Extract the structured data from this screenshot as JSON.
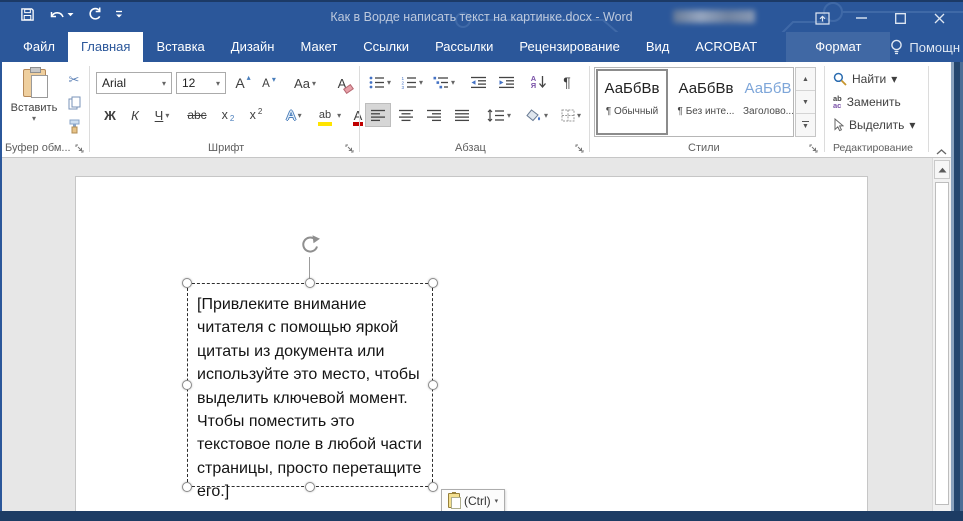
{
  "colors": {
    "accent": "#2b579a",
    "title_edge": "#1c3a66",
    "heading_style_blue": "#7ea6d9",
    "font_color_red": "#c00000",
    "highlight_yellow": "#ffe400"
  },
  "titlebar": {
    "title": "Как в Ворде написать текст на картинке.docx - Word"
  },
  "tabs": [
    {
      "label": "Файл",
      "active": false
    },
    {
      "label": "Главная",
      "active": true
    },
    {
      "label": "Вставка",
      "active": false
    },
    {
      "label": "Дизайн",
      "active": false
    },
    {
      "label": "Макет",
      "active": false
    },
    {
      "label": "Ссылки",
      "active": false
    },
    {
      "label": "Рассылки",
      "active": false
    },
    {
      "label": "Рецензирование",
      "active": false
    },
    {
      "label": "Вид",
      "active": false
    },
    {
      "label": "ACROBAT",
      "active": false
    },
    {
      "label": "Формат",
      "active": false,
      "contextual": true
    }
  ],
  "help_label": "Помощн",
  "icons": {
    "qat": [
      "floppy-save",
      "undo-arrow",
      "redo-arrow",
      "customize-qat-chevron"
    ],
    "window": [
      "ribbon-display-options",
      "minimize",
      "maximize",
      "close"
    ],
    "tab_extras": [
      "lightbulb",
      "person-plus-share",
      "comment-bubble"
    ]
  },
  "ribbon": {
    "clipboard": {
      "paste_label": "Вставить",
      "group_label": "Буфер обм..."
    },
    "font": {
      "family_value": "Arial",
      "size_value": "12",
      "grow_font": "А",
      "shrink_font": "А",
      "change_case": "Aa",
      "clear_format": "А",
      "bold": "Ж",
      "italic": "К",
      "underline": "Ч",
      "strikethrough": "abc",
      "subscript_base": "x",
      "subscript_small": "2",
      "superscript_base": "x",
      "superscript_small": "2",
      "text_effects": "А",
      "highlight": "ab",
      "font_color": "А",
      "group_label": "Шрифт"
    },
    "paragraph": {
      "sort_top": "А",
      "sort_bottom": "Я",
      "pilcrow": "¶",
      "group_label": "Абзац"
    },
    "styles": {
      "items": [
        {
          "preview": "АаБбВв",
          "label": "¶ Обычный"
        },
        {
          "preview": "АаБбВв",
          "label": "¶ Без инте..."
        },
        {
          "preview": "АаБбВ",
          "label": "Заголово..."
        }
      ],
      "group_label": "Стили"
    },
    "editing": {
      "find_label": "Найти",
      "replace_label": "Заменить",
      "select_label": "Выделить",
      "group_label": "Редактирование"
    }
  },
  "document": {
    "textbox_lines": [
      "[Привлеките внимание",
      "читателя с помощью яркой",
      "цитаты из документа или",
      "используйте это место, чтобы",
      "выделить ключевой момент.",
      "Чтобы поместить это",
      "текстовое поле в любой части",
      "страницы, просто перетащите",
      "его.]"
    ],
    "paste_options_label": "(Ctrl)"
  }
}
